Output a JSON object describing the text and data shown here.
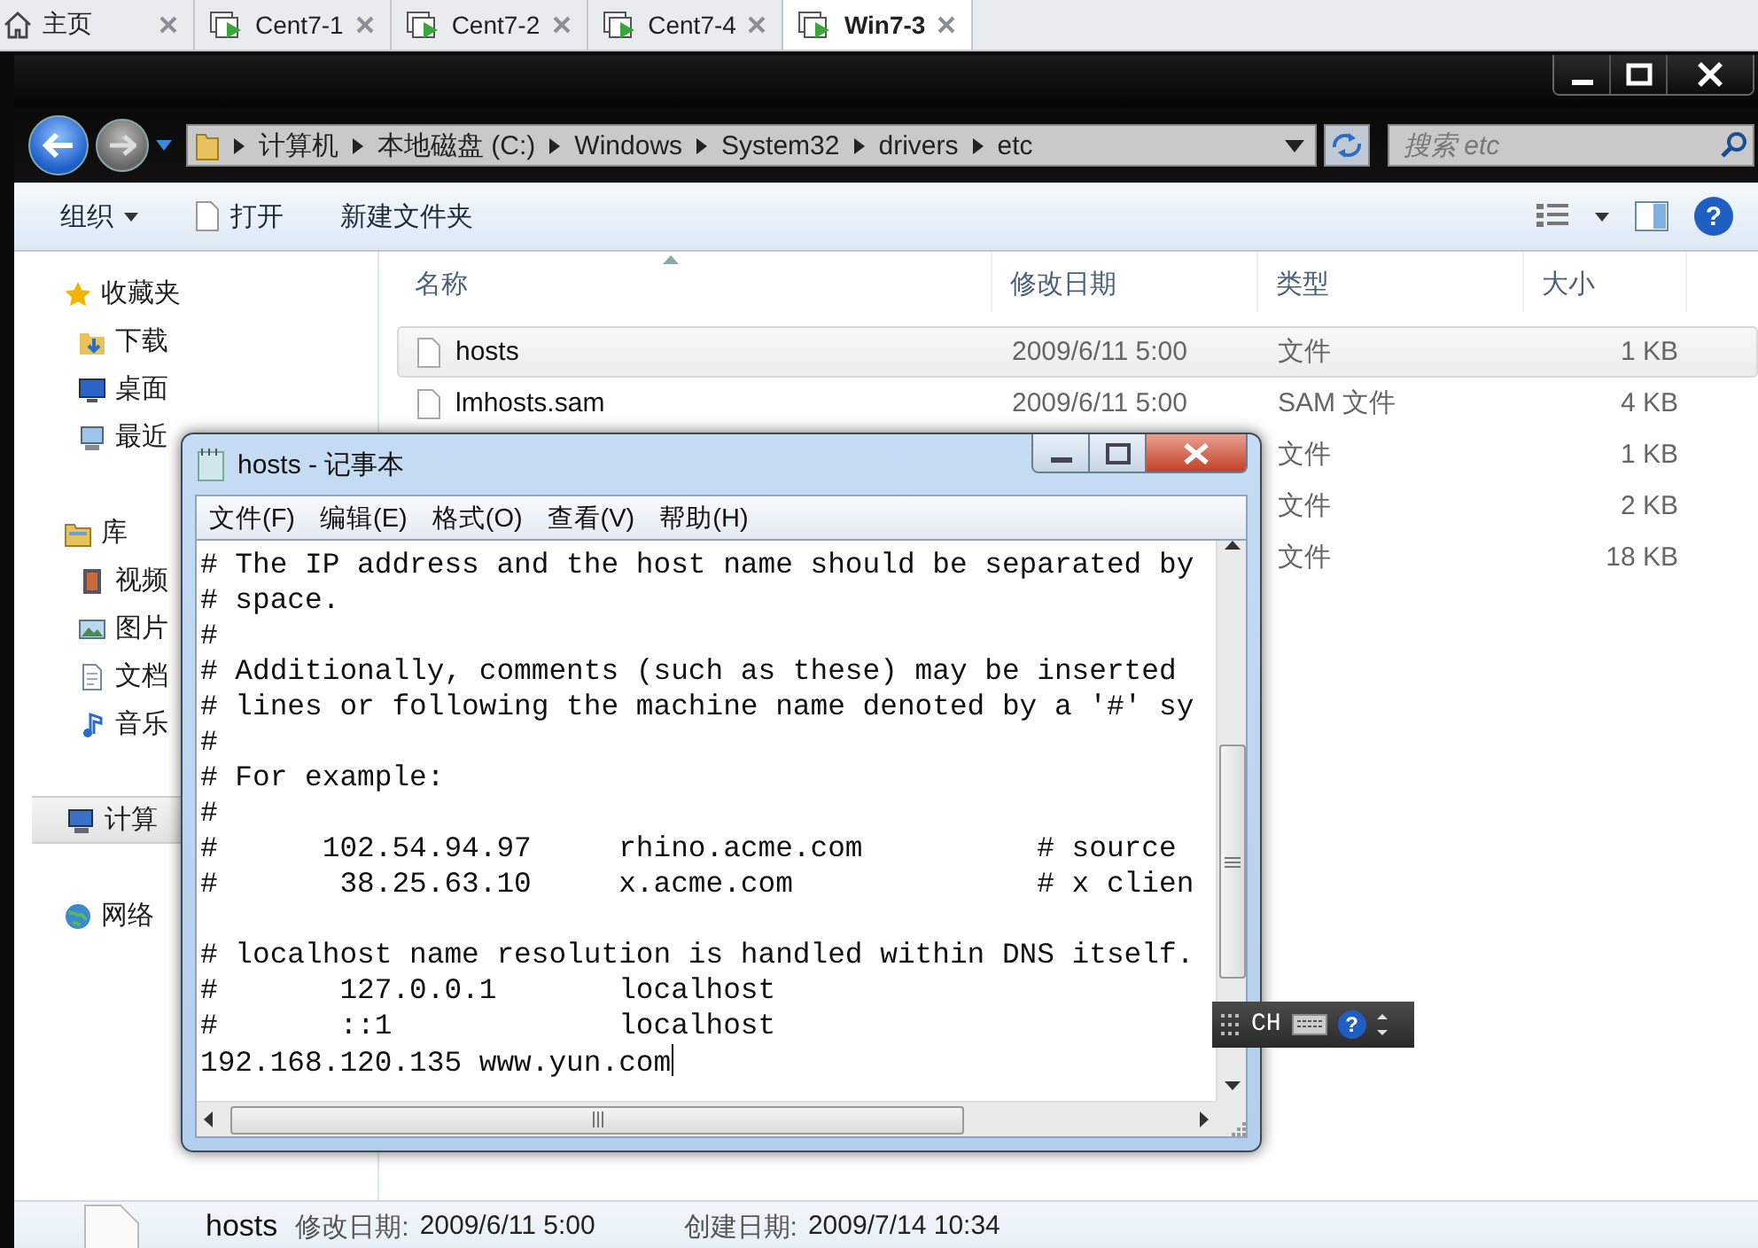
{
  "tabs": [
    {
      "label": "主页",
      "kind": "home",
      "selected": false
    },
    {
      "label": "Cent7-1",
      "kind": "vm",
      "selected": false
    },
    {
      "label": "Cent7-2",
      "kind": "vm",
      "selected": false
    },
    {
      "label": "Cent7-4",
      "kind": "vm",
      "selected": false
    },
    {
      "label": "Win7-3",
      "kind": "vm",
      "selected": true
    }
  ],
  "explorer": {
    "breadcrumb": [
      "计算机",
      "本地磁盘 (C:)",
      "Windows",
      "System32",
      "drivers",
      "etc"
    ],
    "search": {
      "placeholder": "搜索 etc"
    },
    "help_button": "?",
    "toolbar": [
      {
        "label": "组织",
        "kind": "menu"
      },
      {
        "label": "打开",
        "kind": "file"
      },
      {
        "label": "新建文件夹",
        "kind": "plain"
      }
    ],
    "sidebar": [
      {
        "label": "收藏夹",
        "kind": "star",
        "selected": false,
        "children": [
          {
            "label": "下载",
            "kind": "download",
            "selected": false
          },
          {
            "label": "桌面",
            "kind": "desktop",
            "selected": false
          },
          {
            "label": "最近",
            "kind": "recent",
            "selected": false
          }
        ]
      },
      {
        "label": "库",
        "kind": "library",
        "selected": false,
        "children": [
          {
            "label": "视频",
            "kind": "video",
            "selected": false
          },
          {
            "label": "图片",
            "kind": "picture",
            "selected": false
          },
          {
            "label": "文档",
            "kind": "document",
            "selected": false
          },
          {
            "label": "音乐",
            "kind": "music",
            "selected": false
          }
        ]
      },
      {
        "label": "计算",
        "kind": "computer",
        "selected": true
      },
      {
        "label": "网络",
        "kind": "network",
        "selected": false
      }
    ],
    "columns": [
      "名称",
      "修改日期",
      "类型",
      "大小"
    ],
    "rows": [
      {
        "name": "hosts",
        "modified": "2009/6/11 5:00",
        "type": "文件",
        "size": "1 KB",
        "selected": true
      },
      {
        "name": "lmhosts.sam",
        "modified": "2009/6/11 5:00",
        "type": "SAM 文件",
        "size": "4 KB",
        "selected": false
      },
      {
        "type": "文件",
        "size": "1 KB",
        "selected": false
      },
      {
        "type": "文件",
        "size": "2 KB",
        "selected": false
      },
      {
        "type": "文件",
        "size": "18 KB",
        "selected": false
      }
    ],
    "details": {
      "name": "hosts",
      "fields": [
        {
          "label": "修改日期:",
          "value": "2009/6/11 5:00"
        },
        {
          "label": "创建日期:",
          "value": "2009/7/14 10:34"
        }
      ]
    }
  },
  "notepad": {
    "title": "hosts - 记事本",
    "menu": [
      "文件(F)",
      "编辑(E)",
      "格式(O)",
      "查看(V)",
      "帮助(H)"
    ],
    "text": "# The IP address and the host name should be separated by\n# space.\n#\n# Additionally, comments (such as these) may be inserted\n# lines or following the machine name denoted by a '#' sy\n#\n# For example:\n#\n#      102.54.94.97     rhino.acme.com          # source\n#       38.25.63.10     x.acme.com              # x clien\n\n# localhost name resolution is handled within DNS itself.\n#       127.0.0.1       localhost\n#       ::1             localhost\n192.168.120.135 www.yun.com",
    "caret": true
  },
  "ime": {
    "label": "CH",
    "help_button": "?"
  }
}
